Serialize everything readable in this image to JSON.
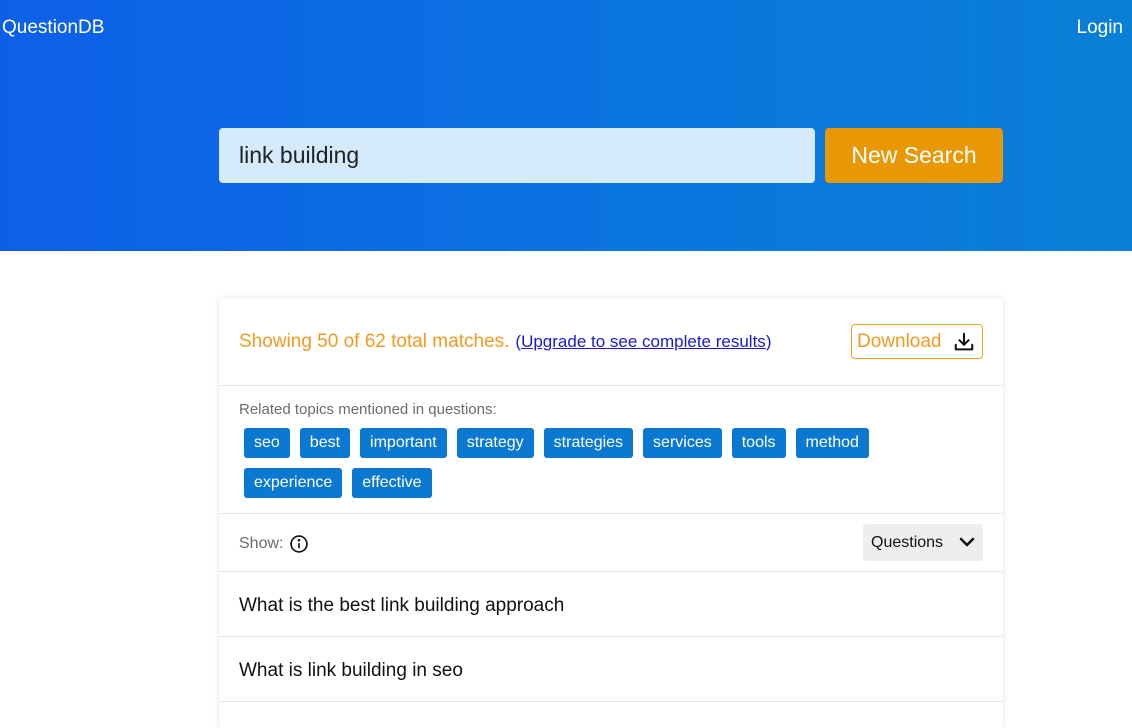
{
  "header": {
    "brand": "QuestionDB",
    "login": "Login"
  },
  "search": {
    "value": "link building",
    "button_label": "New Search"
  },
  "results": {
    "showing_text": "Showing 50 of 62 total matches.",
    "upgrade_prefix": "(",
    "upgrade_link": "Upgrade to see complete results",
    "upgrade_suffix": ")",
    "download_label": "Download"
  },
  "topics": {
    "label": "Related topics mentioned in questions:",
    "tags": [
      "seo",
      "best",
      "important",
      "strategy",
      "strategies",
      "services",
      "tools",
      "method",
      "experience",
      "effective"
    ]
  },
  "show": {
    "label": "Show:",
    "selected": "Questions"
  },
  "questions": [
    "What is the best link building approach",
    "What is link building in seo"
  ],
  "colors": {
    "hero_start": "#0d5fe8",
    "hero_end": "#0a7fd6",
    "accent_orange": "#e89705",
    "tag_blue": "#0b79d2"
  },
  "icons": {
    "download": "download-icon",
    "info": "info-icon",
    "chevron": "chevron-down-icon"
  }
}
